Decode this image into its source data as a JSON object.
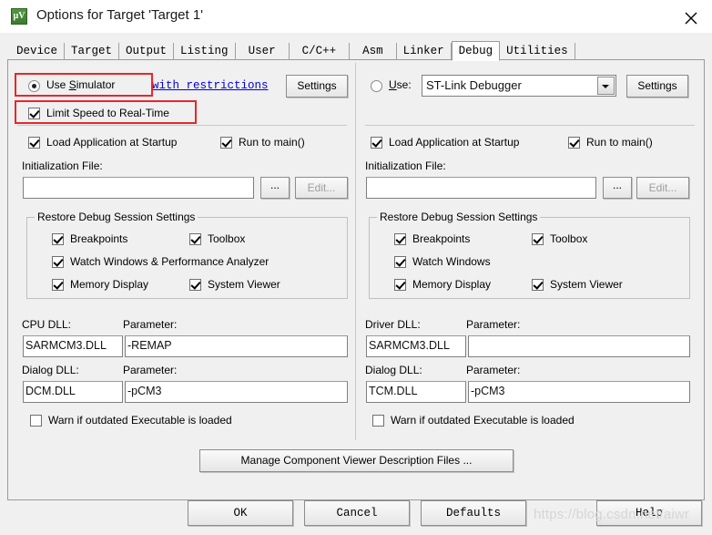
{
  "window": {
    "title": "Options for Target 'Target 1'",
    "icon": "keil-uvision-icon",
    "close_icon": "close-icon"
  },
  "tabs": [
    {
      "label": "Device",
      "selected": false
    },
    {
      "label": "Target",
      "selected": false
    },
    {
      "label": "Output",
      "selected": false
    },
    {
      "label": "Listing",
      "selected": false
    },
    {
      "label": "User",
      "selected": false
    },
    {
      "label": "C/C++",
      "selected": false
    },
    {
      "label": "Asm",
      "selected": false
    },
    {
      "label": "Linker",
      "selected": false
    },
    {
      "label": "Debug",
      "selected": true
    },
    {
      "label": "Utilities",
      "selected": false
    }
  ],
  "simulator": {
    "use_radio_label": "Use Simulator",
    "use_radio_accel": "S",
    "use_radio_checked": true,
    "restrictions_link": "with restrictions",
    "settings_button": "Settings",
    "limit_speed_label": "Limit Speed to Real-Time",
    "limit_speed_checked": true,
    "load_app_label": "Load Application at Startup",
    "load_app_checked": true,
    "run_to_main_label": "Run to main()",
    "run_to_main_checked": true,
    "init_file_label": "Initialization File:",
    "init_file_value": "",
    "browse_button": "...",
    "edit_button": "Edit...",
    "edit_button_disabled": true,
    "restore_group_title": "Restore Debug Session Settings",
    "restore_items": [
      {
        "label": "Breakpoints",
        "checked": true
      },
      {
        "label": "Toolbox",
        "checked": true
      },
      {
        "label": "Watch Windows & Performance Analyzer",
        "checked": true
      },
      {
        "label": "Memory Display",
        "checked": true
      },
      {
        "label": "System Viewer",
        "checked": true
      }
    ],
    "cpu_dll_label": "CPU DLL:",
    "cpu_dll_value": "SARMCM3.DLL",
    "cpu_param_label": "Parameter:",
    "cpu_param_value": "-REMAP",
    "dialog_dll_label": "Dialog DLL:",
    "dialog_dll_value": "DCM.DLL",
    "dialog_param_label": "Parameter:",
    "dialog_param_value": "-pCM3",
    "warn_label": "Warn if outdated Executable is loaded",
    "warn_checked": false
  },
  "hardware": {
    "use_radio_label": "Use:",
    "use_radio_accel": "U",
    "use_radio_checked": false,
    "debugger_selected": "ST-Link Debugger",
    "settings_button": "Settings",
    "load_app_label": "Load Application at Startup",
    "load_app_checked": true,
    "run_to_main_label": "Run to main()",
    "run_to_main_checked": true,
    "init_file_label": "Initialization File:",
    "init_file_value": "",
    "browse_button": "...",
    "edit_button": "Edit...",
    "edit_button_disabled": true,
    "restore_group_title": "Restore Debug Session Settings",
    "restore_items": [
      {
        "label": "Breakpoints",
        "checked": true
      },
      {
        "label": "Toolbox",
        "checked": true
      },
      {
        "label": "Watch Windows",
        "checked": true
      },
      {
        "label": "Memory Display",
        "checked": true
      },
      {
        "label": "System Viewer",
        "checked": true
      }
    ],
    "driver_dll_label": "Driver DLL:",
    "driver_dll_value": "SARMCM3.DLL",
    "driver_param_label": "Parameter:",
    "driver_param_value": "",
    "dialog_dll_label": "Dialog DLL:",
    "dialog_dll_value": "TCM.DLL",
    "dialog_param_label": "Parameter:",
    "dialog_param_value": "-pCM3",
    "warn_label": "Warn if outdated Executable is loaded",
    "warn_checked": false
  },
  "manage_button": "Manage Component Viewer Description Files ...",
  "footer": {
    "ok": "OK",
    "cancel": "Cancel",
    "defaults": "Defaults",
    "help": "Help"
  },
  "watermark": "https://blog.csdn.net/aiwr",
  "highlight_color": "#e8262b"
}
